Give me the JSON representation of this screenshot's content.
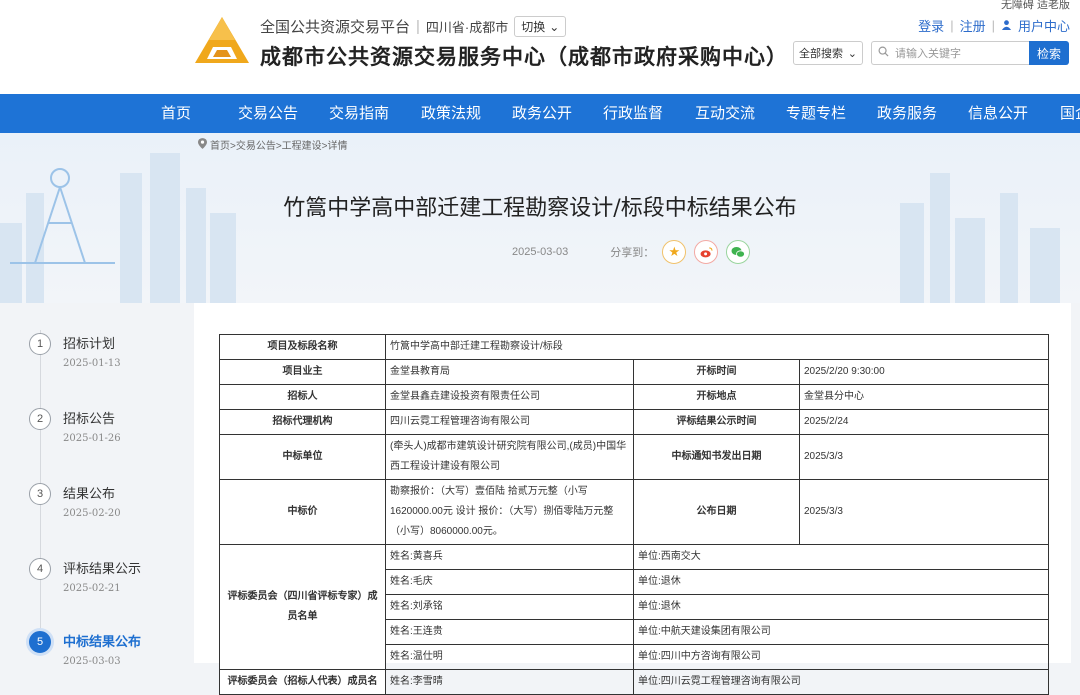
{
  "header": {
    "accessibility": "无障碍 适老版",
    "platform": "全国公共资源交易平台",
    "region": "四川省·成都市",
    "switch_label": "切换",
    "site_name": "成都市公共资源交易服务中心（成都市政府采购中心）",
    "login": "登录",
    "register": "注册",
    "user_center": "用户中心",
    "search_scope": "全部搜索",
    "search_placeholder": "请输入关键字",
    "search_button": "检索",
    "colors": {
      "brand": "#1e73d6",
      "logo": "#f0a81c"
    }
  },
  "nav": [
    "首页",
    "交易公告",
    "交易指南",
    "政策法规",
    "政务公开",
    "行政监督",
    "互动交流",
    "专题专栏",
    "政务服务",
    "信息公开",
    "国企"
  ],
  "breadcrumb": "首页>交易公告>工程建设>详情",
  "article": {
    "title": "竹篙中学高中部迁建工程勘察设计/标段中标结果公布",
    "date": "2025-03-03",
    "share_label": "分享到：",
    "share_icons": [
      "star-icon",
      "weibo-icon",
      "wechat-icon"
    ]
  },
  "timeline": [
    {
      "num": "1",
      "label": "招标计划",
      "date": "2025-01-13"
    },
    {
      "num": "2",
      "label": "招标公告",
      "date": "2025-01-26"
    },
    {
      "num": "3",
      "label": "结果公布",
      "date": "2025-02-20"
    },
    {
      "num": "4",
      "label": "评标结果公示",
      "date": "2025-02-21"
    },
    {
      "num": "5",
      "label": "中标结果公布",
      "date": "2025-03-03",
      "active": true
    }
  ],
  "table": {
    "project_name_label": "项目及标段名称",
    "project_name": "竹篙中学高中部迁建工程勘察设计/标段",
    "owner_label": "项目业主",
    "owner": "金堂县教育局",
    "open_time_label": "开标时间",
    "open_time": "2025/2/20 9:30:00",
    "tenderer_label": "招标人",
    "tenderer": "金堂县鑫垚建设投资有限责任公司",
    "open_place_label": "开标地点",
    "open_place": "金堂县分中心",
    "agency_label": "招标代理机构",
    "agency": "四川云霓工程管理咨询有限公司",
    "review_time_label": "评标结果公示时间",
    "review_time": "2025/2/24",
    "winner_label": "中标单位",
    "winner": "(牵头人)成都市建筑设计研究院有限公司,(成员)中国华西工程设计建设有限公司",
    "notice_date_label": "中标通知书发出日期",
    "notice_date": "2025/3/3",
    "price_label": "中标价",
    "price": "勘察报价：（大写）壹佰陆 拾贰万元整（小写 1620000.00元 设计 报价：（大写）捌佰零陆万元整（小写）8060000.00元。",
    "publish_date_label": "公布日期",
    "publish_date": "2025/3/3",
    "committee_label": "评标委员会（四川省评标专家）成员名单",
    "committee": [
      {
        "name": "姓名:黄喜兵",
        "unit": "单位:西南交大"
      },
      {
        "name": "姓名:毛庆",
        "unit": "单位:退休"
      },
      {
        "name": "姓名:刘承铭",
        "unit": "单位:退休"
      },
      {
        "name": "姓名:王连贵",
        "unit": "单位:中航天建设集团有限公司"
      },
      {
        "name": "姓名:温仕明",
        "unit": "单位:四川中方咨询有限公司"
      }
    ],
    "committee2_label": "评标委员会（招标人代表）成员名",
    "committee2_name": "姓名:李雪晴",
    "committee2_unit": "单位:四川云霓工程管理咨询有限公司"
  }
}
